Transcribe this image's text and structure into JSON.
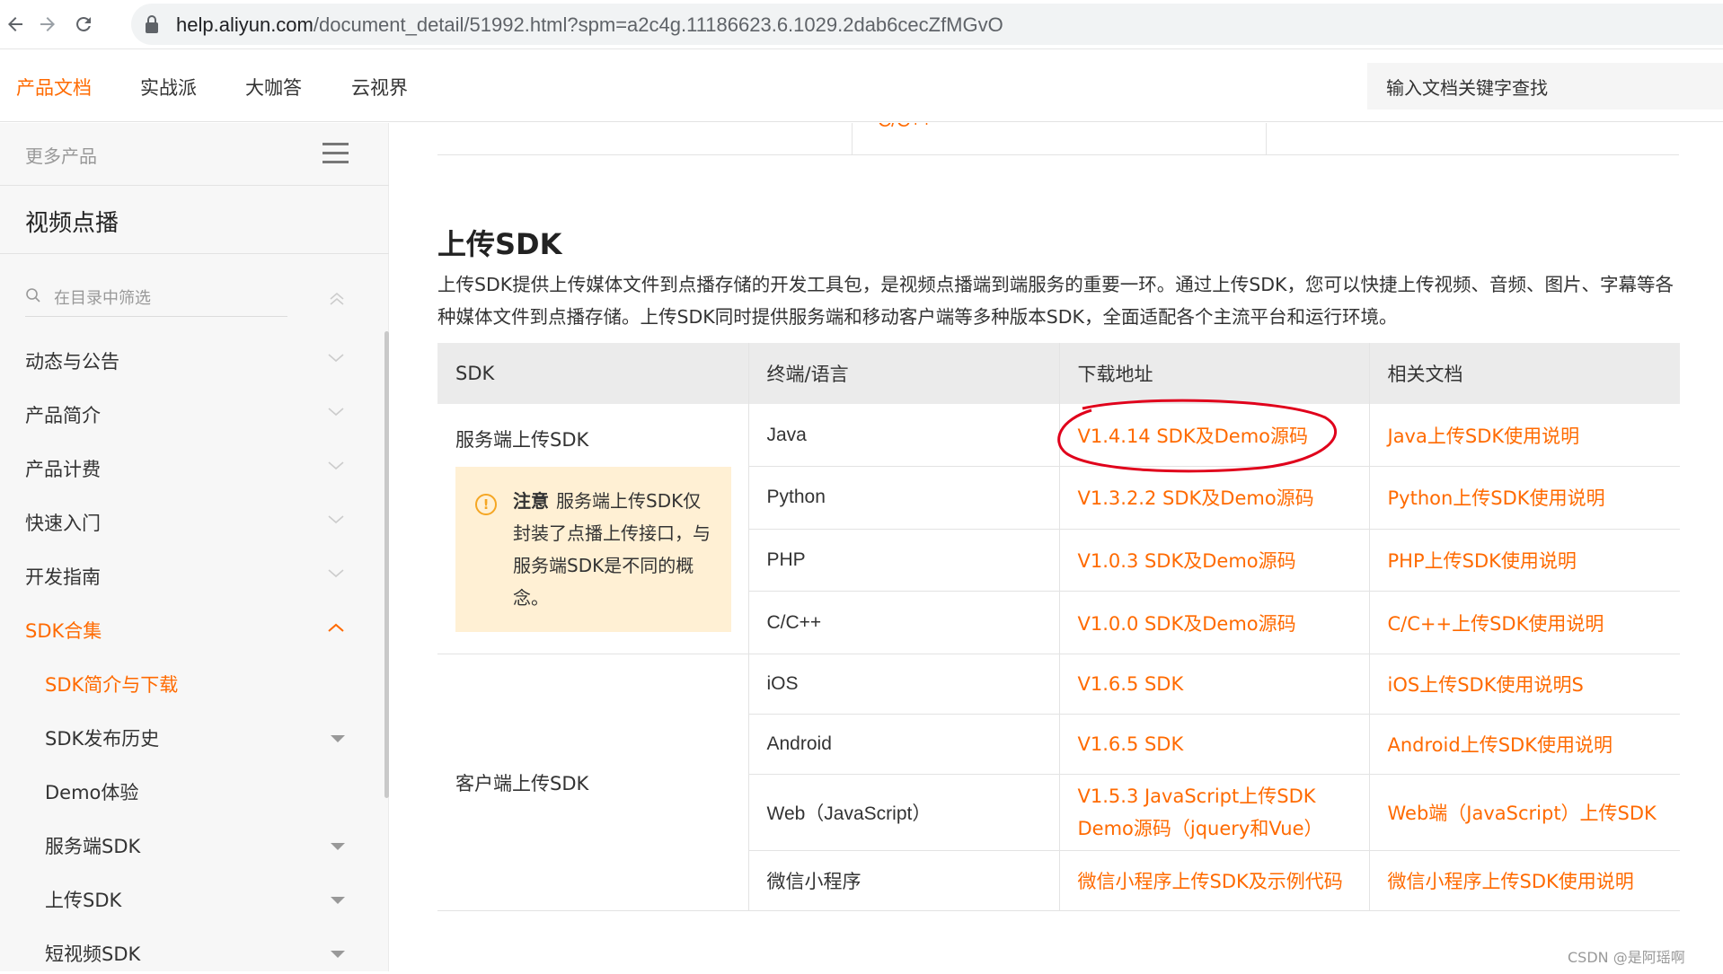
{
  "browser": {
    "url_host": "help.aliyun.com",
    "url_path": "/document_detail/51992.html?spm=a2c4g.11186623.6.1029.2dab6cecZfMGvO"
  },
  "top_nav": {
    "items": [
      "产品文档",
      "实战派",
      "大咖答",
      "云视界"
    ],
    "search_placeholder": "输入文档关键字查找"
  },
  "sidebar": {
    "more_products": "更多产品",
    "product_title": "视频点播",
    "filter_placeholder": "在目录中筛选",
    "items": [
      {
        "label": "动态与公告"
      },
      {
        "label": "产品简介"
      },
      {
        "label": "产品计费"
      },
      {
        "label": "快速入门"
      },
      {
        "label": "开发指南"
      },
      {
        "label": "SDK合集"
      },
      {
        "label": "SDK简介与下载"
      },
      {
        "label": "SDK发布历史"
      },
      {
        "label": "Demo体验"
      },
      {
        "label": "服务端SDK"
      },
      {
        "label": "上传SDK"
      },
      {
        "label": "短视频SDK"
      }
    ]
  },
  "main": {
    "prev_table_cut_text": "C/C++",
    "section_title": "上传SDK",
    "intro": "上传SDK提供上传媒体文件到点播存储的开发工具包，是视频点播端到端服务的重要一环。通过上传SDK，您可以快捷上传视频、音频、图片、字幕等各种媒体文件到点播存储。上传SDK同时提供服务端和移动客户端等多种版本SDK，全面适配各个主流平台和运行环境。",
    "table": {
      "headers": [
        "SDK",
        "终端/语言",
        "下载地址",
        "相关文档"
      ],
      "server_group": "服务端上传SDK",
      "note_title": "注意",
      "note_text": "服务端上传SDK仅封装了点播上传接口，与服务端SDK是不同的概念。",
      "client_group": "客户端上传SDK",
      "rows": [
        {
          "lang": "Java",
          "download": "V1.4.14 SDK及Demo源码",
          "doc": "Java上传SDK使用说明"
        },
        {
          "lang": "Python",
          "download": "V1.3.2.2 SDK及Demo源码",
          "doc": "Python上传SDK使用说明"
        },
        {
          "lang": "PHP",
          "download": "V1.0.3 SDK及Demo源码",
          "doc": "PHP上传SDK使用说明"
        },
        {
          "lang": "C/C++",
          "download": "V1.0.0 SDK及Demo源码",
          "doc": "C/C++上传SDK使用说明"
        },
        {
          "lang": "iOS",
          "download": "V1.6.5 SDK",
          "doc": "iOS上传SDK使用说明S"
        },
        {
          "lang": "Android",
          "download": "V1.6.5 SDK",
          "doc": "Android上传SDK使用说明"
        },
        {
          "lang": "Web（JavaScript）",
          "download": "V1.5.3 JavaScript上传SDK Demo源码（jquery和Vue）",
          "doc": "Web端（JavaScript）上传SDK"
        },
        {
          "lang": "微信小程序",
          "download": "微信小程序上传SDK及示例代码",
          "doc": "微信小程序上传SDK使用说明"
        }
      ]
    }
  },
  "watermark": "CSDN @是阿瑶啊",
  "colors": {
    "accent": "#ff6a00",
    "note_bg": "#fff0d4",
    "header_bg": "#ebebeb",
    "annotation": "#e0001b"
  }
}
